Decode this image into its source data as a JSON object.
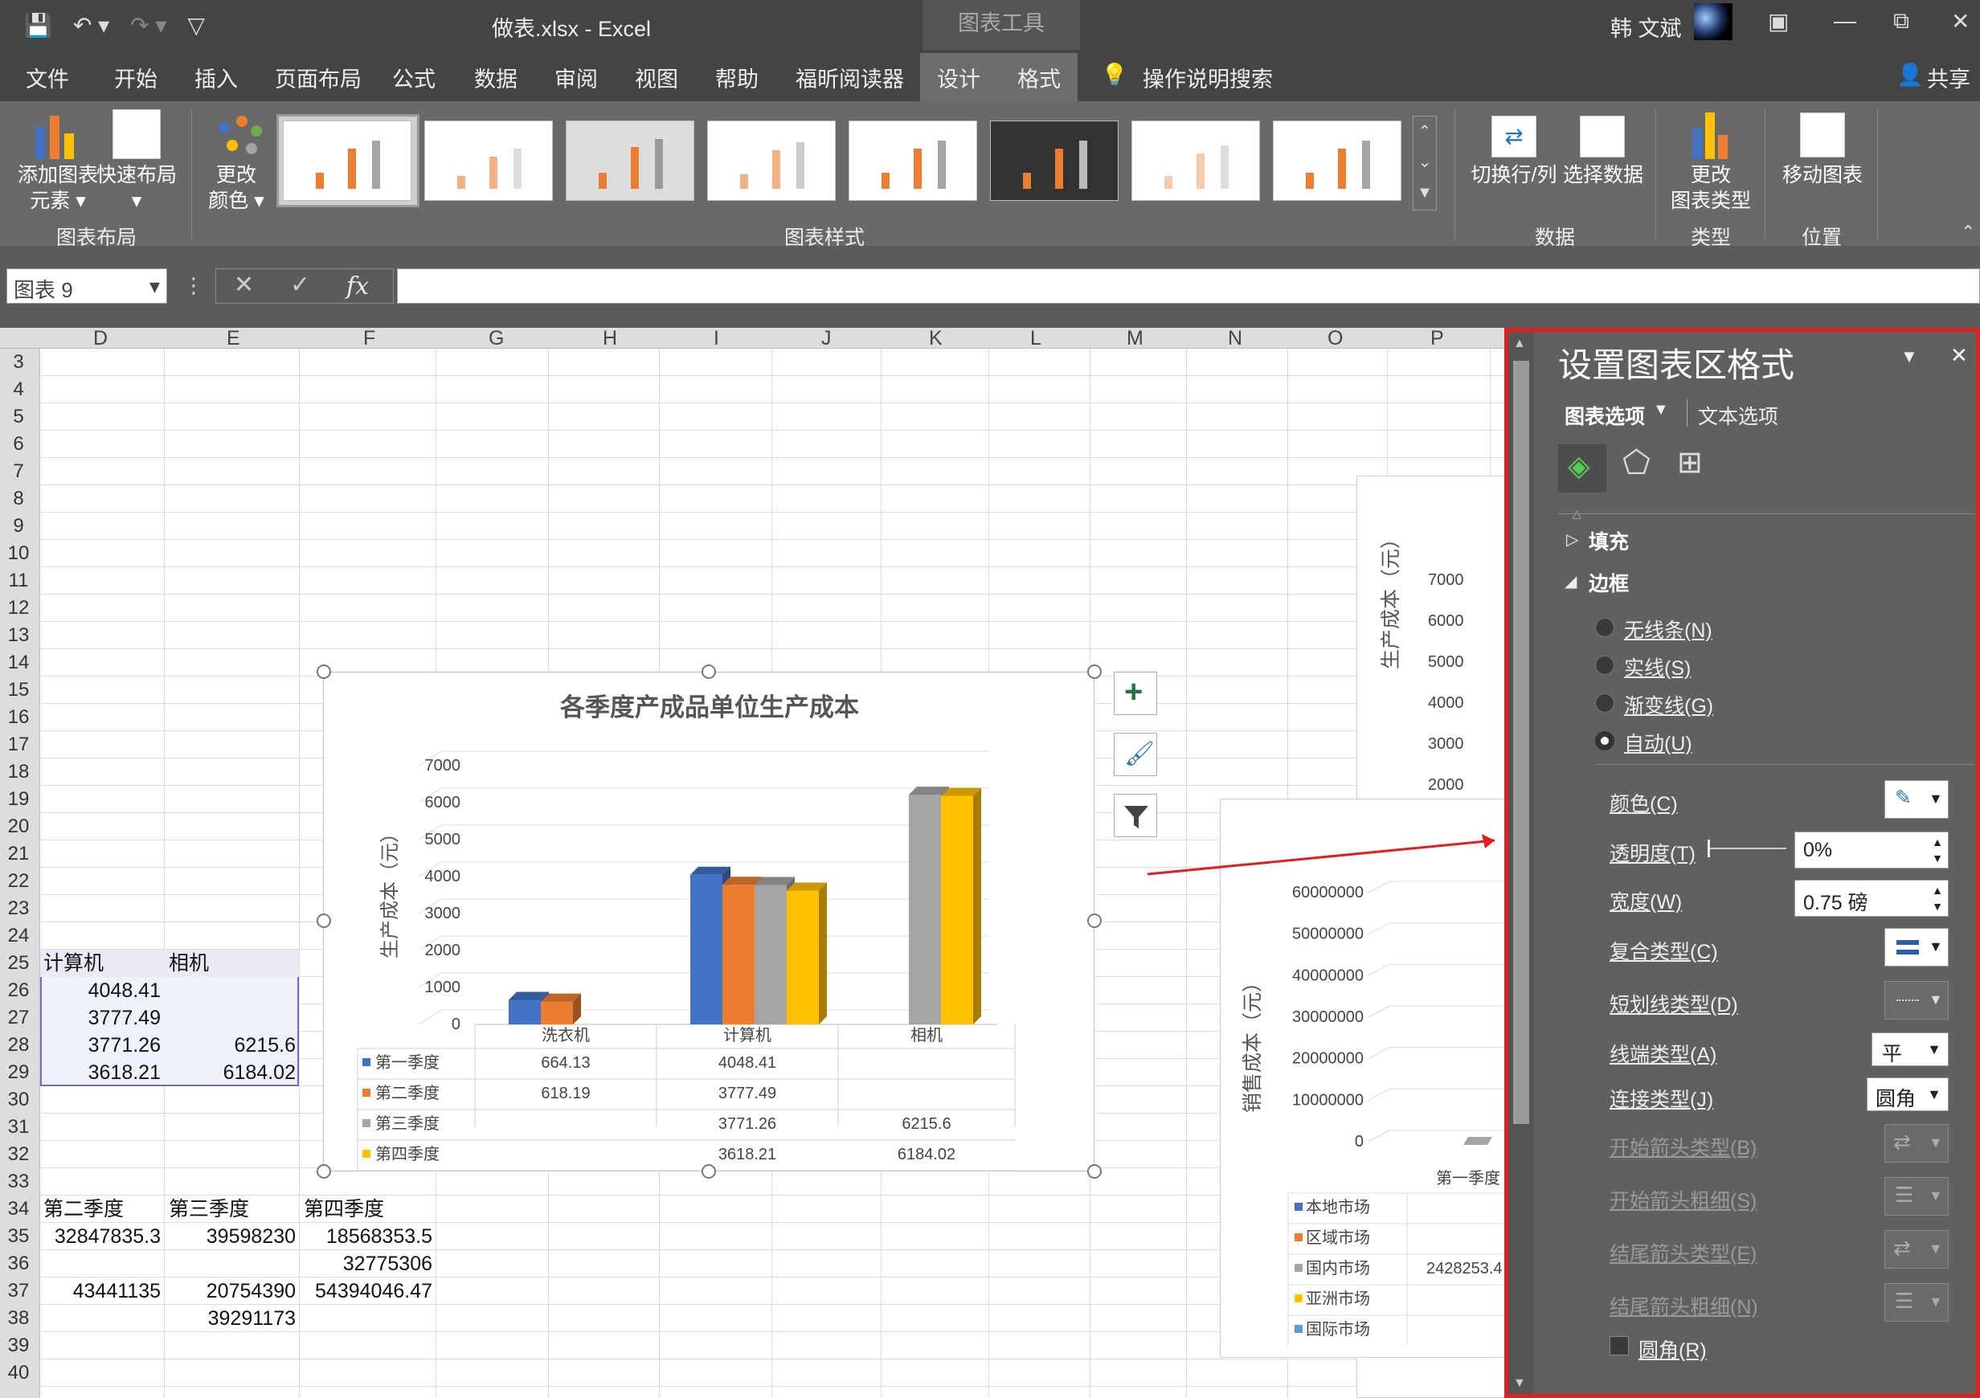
{
  "titlebar": {
    "file_title": "做表.xlsx  -  Excel",
    "context_tab": "图表工具",
    "user": "韩 文斌"
  },
  "menu": [
    "文件",
    "开始",
    "插入",
    "页面布局",
    "公式",
    "数据",
    "审阅",
    "视图",
    "帮助",
    "福昕阅读器",
    "设计",
    "格式"
  ],
  "menu_selected": "设计",
  "search_label": "操作说明搜索",
  "share_label": "共享",
  "ribbon": {
    "add_element": "添加图表\n元素 ▾",
    "quick_layout": "快速布局\n▾",
    "change_color": "更改\n颜色 ▾",
    "group_layout": "图表布局",
    "group_styles": "图表样式",
    "switch_rowcol": "切换行/列",
    "select_data": "选择数据",
    "group_data": "数据",
    "change_type": "更改\n图表类型",
    "group_type": "类型",
    "move_chart": "移动图表",
    "group_location": "位置"
  },
  "formula_bar": {
    "name_box": "图表 9",
    "fx": "fx"
  },
  "columns": [
    "D",
    "E",
    "F",
    "G",
    "H",
    "I",
    "J",
    "K",
    "L",
    "M",
    "N",
    "O",
    "P"
  ],
  "rows": [
    "3",
    "4",
    "5",
    "6",
    "7",
    "8",
    "9",
    "10",
    "11",
    "12",
    "13",
    "14",
    "15",
    "16",
    "17",
    "18",
    "19",
    "20",
    "21",
    "22",
    "23",
    "24",
    "25",
    "26",
    "27",
    "28",
    "29",
    "30",
    "31",
    "32",
    "33",
    "34",
    "35",
    "36",
    "37",
    "38",
    "39",
    "40"
  ],
  "cells": {
    "d25": "计算机",
    "e25": "相机",
    "d26": "4048.41",
    "d27": "3777.49",
    "d28": "3771.26",
    "e28": "6215.6",
    "d29": "3618.21",
    "e29": "6184.02",
    "d34": "第二季度",
    "e34": "第三季度",
    "f34": "第四季度",
    "d35": "32847835.3",
    "e35": "39598230",
    "f35": "18568353.5",
    "f36": "32775306",
    "d37": "43441135",
    "e37": "20754390",
    "f37": "54394046.47",
    "e38": "39291173"
  },
  "chart_data": [
    {
      "type": "bar",
      "title": "各季度产成品单位生产成本",
      "ylabel": "生产成本（元）",
      "ylim": [
        0,
        7000
      ],
      "yticks": [
        "7000",
        "6000",
        "5000",
        "4000",
        "3000",
        "2000",
        "1000",
        "0"
      ],
      "categories": [
        "洗衣机",
        "计算机",
        "相机"
      ],
      "series": [
        {
          "name": "第一季度",
          "color": "#4472c4",
          "values": [
            664.13,
            4048.41,
            null
          ],
          "labels": [
            "664.13",
            "4048.41",
            ""
          ]
        },
        {
          "name": "第二季度",
          "color": "#ed7d31",
          "values": [
            618.19,
            3777.49,
            null
          ],
          "labels": [
            "618.19",
            "3777.49",
            ""
          ]
        },
        {
          "name": "第三季度",
          "color": "#a5a5a5",
          "values": [
            null,
            3771.26,
            6215.6
          ],
          "labels": [
            "",
            "3771.26",
            "6215.6"
          ]
        },
        {
          "name": "第四季度",
          "color": "#ffc000",
          "values": [
            null,
            3618.21,
            6184.02
          ],
          "labels": [
            "",
            "3618.21",
            "6184.02"
          ]
        }
      ]
    },
    {
      "type": "bar",
      "ylabel": "销售成本（元）",
      "ylim": [
        0,
        60000000
      ],
      "yticks": [
        "60000000",
        "50000000",
        "40000000",
        "30000000",
        "20000000",
        "10000000",
        "0"
      ],
      "categories": [
        "第一季度"
      ],
      "series": [
        {
          "name": "本地市场",
          "color": "#4472c4"
        },
        {
          "name": "区域市场",
          "color": "#ed7d31"
        },
        {
          "name": "国内市场",
          "color": "#a5a5a5",
          "labels": [
            "2428253.4"
          ]
        },
        {
          "name": "亚洲市场",
          "color": "#ffc000"
        },
        {
          "name": "国际市场",
          "color": "#5b9bd5"
        }
      ]
    },
    {
      "type": "bar",
      "ylabel": "生产成本（元）",
      "yticks": [
        "7000",
        "6000",
        "5000",
        "4000",
        "3000",
        "2000"
      ]
    }
  ],
  "pane": {
    "title": "设置图表区格式",
    "tab_chart": "图表选项",
    "tab_text": "文本选项",
    "fill": "填充",
    "border": "边框",
    "opt_none": "无线条(N)",
    "opt_solid": "实线(S)",
    "opt_gradient": "渐变线(G)",
    "opt_auto": "自动(U)",
    "color": "颜色(C)",
    "transparency": "透明度(T)",
    "transparency_value": "0%",
    "width": "宽度(W)",
    "width_value": "0.75 磅",
    "compound": "复合类型(C)",
    "dash": "短划线类型(D)",
    "cap": "线端类型(A)",
    "cap_value": "平",
    "join": "连接类型(J)",
    "join_value": "圆角",
    "begin_arrow_type": "开始箭头类型(B)",
    "begin_arrow_size": "开始箭头粗细(S)",
    "end_arrow_type": "结尾箭头类型(E)",
    "end_arrow_size": "结尾箭头粗细(N)",
    "rounded": "圆角(R)"
  }
}
